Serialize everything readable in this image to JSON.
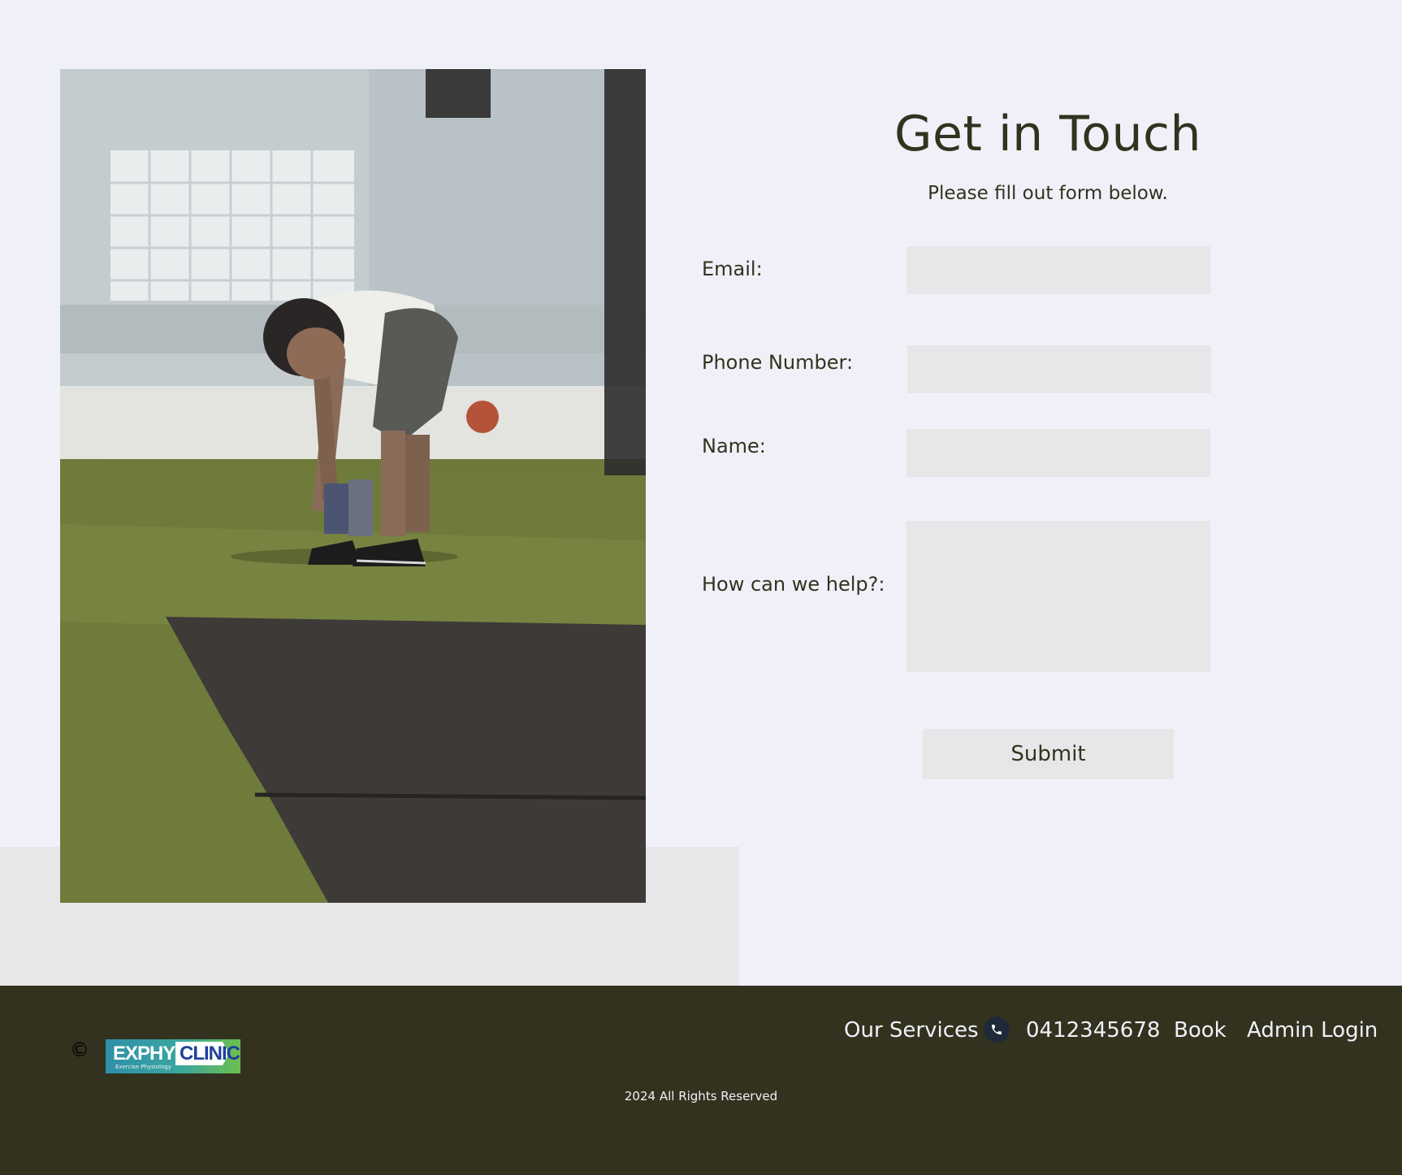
{
  "form": {
    "title": "Get in Touch",
    "subtitle": "Please fill out form below.",
    "email_label": "Email:",
    "email_value": "",
    "phone_label": "Phone Number:",
    "phone_value": "",
    "name_label": "Name:",
    "name_value": "",
    "help_label": "How can we help?:",
    "help_value": "",
    "submit_label": "Submit"
  },
  "footer": {
    "copyright_symbol": "©",
    "logo": {
      "word1": "EXPHYS",
      "word2": "CLINIC",
      "tagline": "Exercise Physiology"
    },
    "nav": {
      "services": "Our Services",
      "phone": "0412345678",
      "book": "Book",
      "admin": "Admin Login"
    },
    "rights": "2024 All Rights Reserved"
  },
  "icons": {
    "phone": "phone-icon"
  },
  "colors": {
    "background": "#f0f1f8",
    "field": "#e7e6e8",
    "text": "#33321f",
    "footer": "#33321f"
  }
}
